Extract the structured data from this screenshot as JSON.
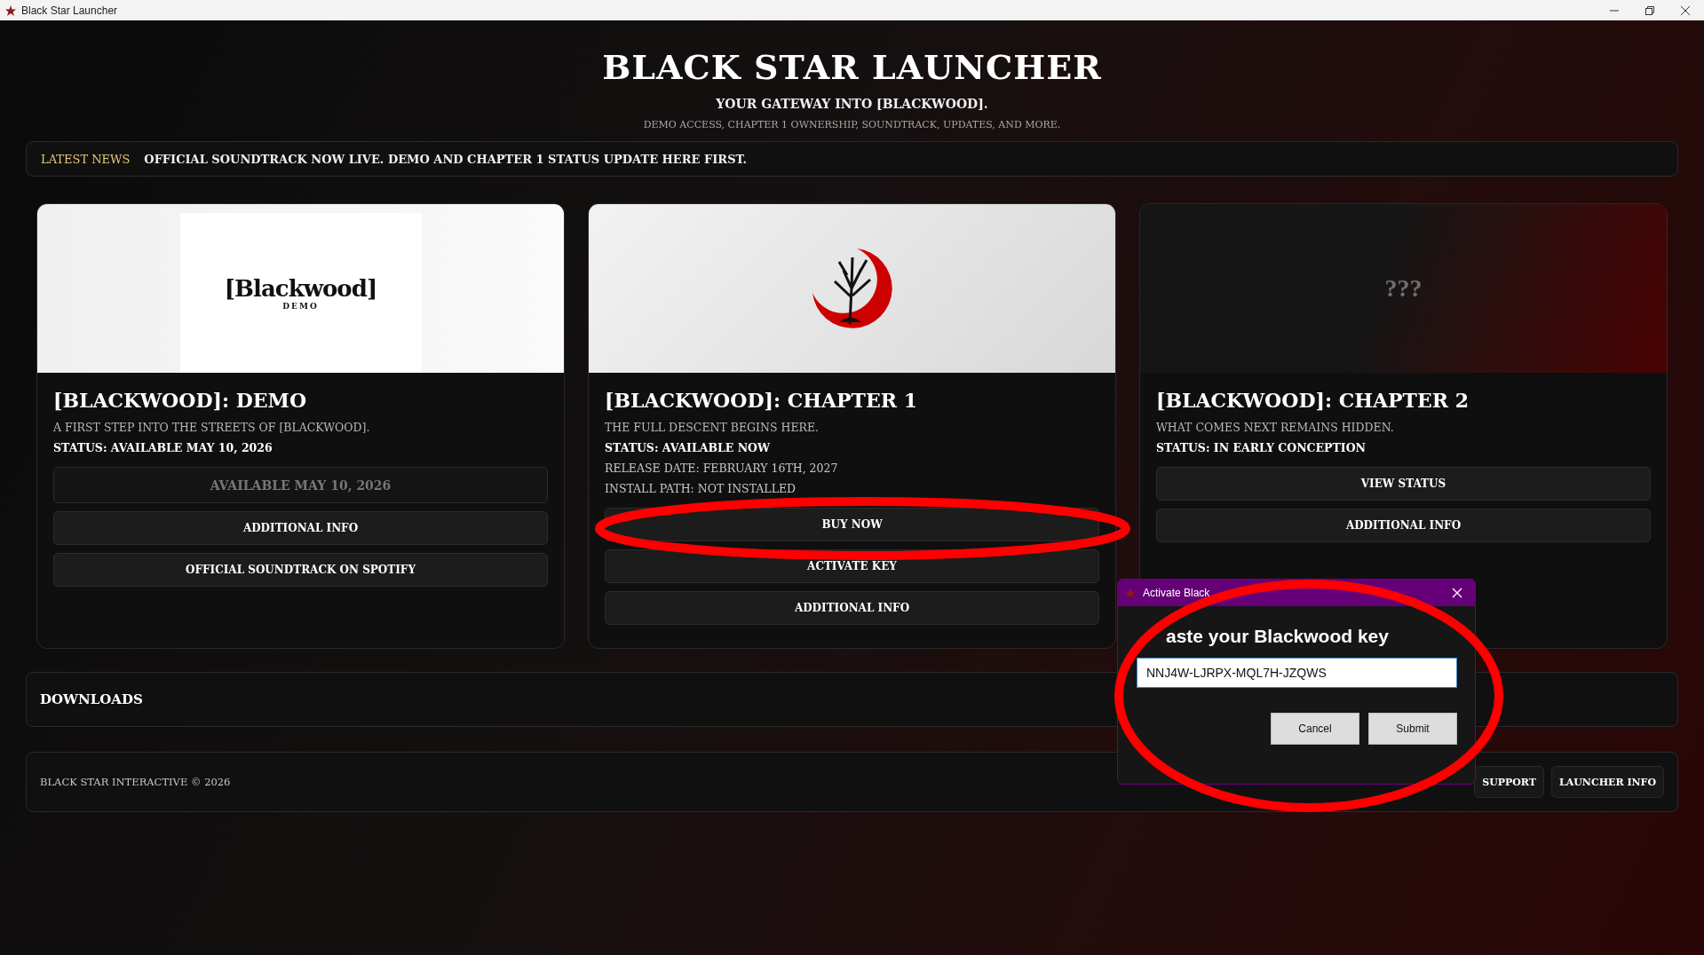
{
  "window": {
    "title": "Black Star Launcher"
  },
  "header": {
    "title": "BLACK STAR LAUNCHER",
    "subtitle": "YOUR GATEWAY INTO [BLACKWOOD].",
    "tagline": "DEMO ACCESS, CHAPTER 1 OWNERSHIP, SOUNDTRACK, UPDATES, AND MORE."
  },
  "news": {
    "label": "LATEST NEWS",
    "text": "OFFICIAL SOUNDTRACK NOW LIVE. DEMO AND CHAPTER 1 STATUS UPDATE HERE FIRST."
  },
  "cards": [
    {
      "image": {
        "kind": "logo",
        "logo_text": "[Blackwood]",
        "logo_subtext": "DEMO"
      },
      "title": "[BLACKWOOD]: DEMO",
      "description": "A FIRST STEP INTO THE STREETS OF [BLACKWOOD].",
      "lines": [
        {
          "kind": "status",
          "text": "STATUS: AVAILABLE MAY 10, 2026"
        }
      ],
      "buttons": [
        {
          "label": "AVAILABLE MAY 10, 2026",
          "disabled": true
        },
        {
          "label": "ADDITIONAL INFO",
          "disabled": false
        },
        {
          "label": "OFFICIAL SOUNDTRACK ON SPOTIFY",
          "disabled": false
        }
      ]
    },
    {
      "image": {
        "kind": "emblem"
      },
      "title": "[BLACKWOOD]: CHAPTER 1",
      "description": "THE FULL DESCENT BEGINS HERE.",
      "lines": [
        {
          "kind": "status",
          "text": "STATUS: AVAILABLE NOW"
        },
        {
          "kind": "detail",
          "text": "RELEASE DATE: FEBRUARY 16TH, 2027"
        },
        {
          "kind": "detail",
          "text": "INSTALL PATH: NOT INSTALLED"
        }
      ],
      "buttons": [
        {
          "label": "BUY NOW",
          "disabled": false
        },
        {
          "label": "ACTIVATE KEY",
          "disabled": false
        },
        {
          "label": "ADDITIONAL INFO",
          "disabled": false
        }
      ]
    },
    {
      "image": {
        "kind": "mystery",
        "mystery_text": "???"
      },
      "title": "[BLACKWOOD]: CHAPTER 2",
      "description": "WHAT COMES NEXT REMAINS HIDDEN.",
      "lines": [
        {
          "kind": "status",
          "text": "STATUS: IN EARLY CONCEPTION"
        }
      ],
      "buttons": [
        {
          "label": "VIEW STATUS",
          "disabled": false
        },
        {
          "label": "ADDITIONAL INFO",
          "disabled": false
        }
      ]
    }
  ],
  "downloads": {
    "title": "DOWNLOADS"
  },
  "footer": {
    "copyright": "BLACK STAR INTERACTIVE © 2026",
    "buttons": [
      "SUPPORT",
      "LAUNCHER INFO"
    ]
  },
  "dialog": {
    "title": "Activate Black",
    "heading": "aste your Blackwood key",
    "value": "NNJ4W-LJRPX-MQL7H-JZQWS",
    "buttons": [
      "Cancel",
      "Submit"
    ]
  },
  "annotations": [
    {
      "kind": "ellipse"
    },
    {
      "kind": "ellipse"
    }
  ]
}
